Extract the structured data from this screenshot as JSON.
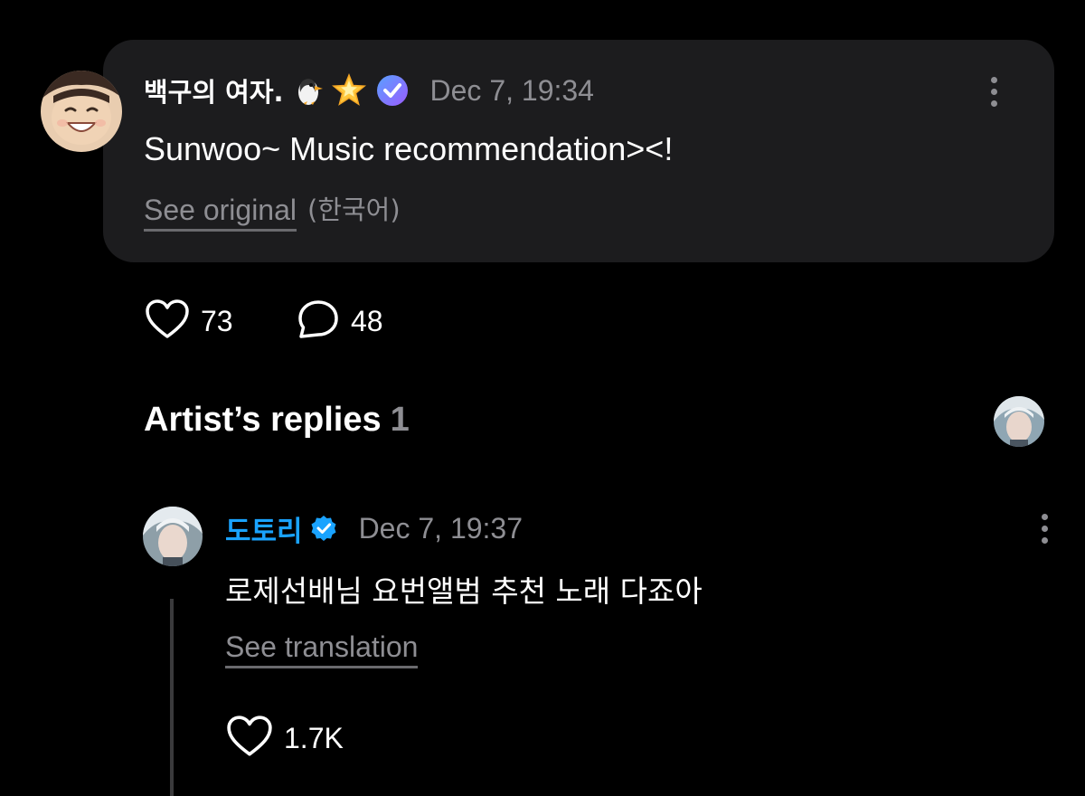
{
  "post": {
    "author": "백구의 여자.",
    "emoji_1": "penguin",
    "emoji_2": "glowing-star",
    "badge_icon": "member-badge-icon",
    "timestamp": "Dec 7, 19:34",
    "body": "Sunwoo~ Music recommendation><!",
    "see_original_label": "See original",
    "original_language": "(한국어)",
    "likes": "73",
    "comments": "48"
  },
  "artist_replies": {
    "title": "Artist’s replies",
    "count": "1"
  },
  "reply": {
    "author": "도토리",
    "timestamp": "Dec 7, 19:37",
    "body": "로제선배님 요번앨범 추천 노래 다죠아",
    "see_translation_label": "See translation",
    "likes": "1.7K"
  },
  "colors": {
    "background": "#000000",
    "card": "#1c1c1e",
    "secondary_text": "#8e8e93",
    "artist_name": "#1aa3ff",
    "badge_purple": "#7b5cff"
  }
}
